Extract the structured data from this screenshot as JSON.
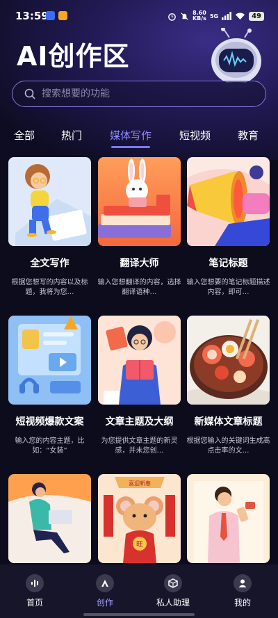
{
  "status": {
    "time": "13:59",
    "speed_value": "8.60",
    "speed_unit": "KB/s",
    "network": "5G",
    "battery": "49"
  },
  "header": {
    "title": "AI创作区"
  },
  "search": {
    "placeholder": "搜索想要的功能"
  },
  "tabs": [
    {
      "label": "全部"
    },
    {
      "label": "热门"
    },
    {
      "label": "媒体写作",
      "active": true
    },
    {
      "label": "短视频"
    },
    {
      "label": "教育"
    }
  ],
  "cards": [
    {
      "title": "全文写作",
      "desc": "根据您想写的内容以及标题，我将为您…"
    },
    {
      "title": "翻译大师",
      "desc": "输入您想翻译的内容，选择翻译语种…"
    },
    {
      "title": "笔记标题",
      "desc": "输入您想要的笔记标题描述内容，即可…"
    },
    {
      "title": "短视频爆款文案",
      "desc": "输入您的内容主题，比如：“女装”"
    },
    {
      "title": "文章主题及大纲",
      "desc": "为您提供文章主题的新灵感，并未您创…"
    },
    {
      "title": "新媒体文章标题",
      "desc": "根据您输入的关键词生成高点击率的文…"
    },
    {
      "title": "",
      "desc": ""
    },
    {
      "title": "",
      "desc": "",
      "poster_text": "喜迎新春",
      "badge": "旺"
    },
    {
      "title": "",
      "desc": ""
    }
  ],
  "nav": [
    {
      "label": "首页",
      "icon": "voice-icon"
    },
    {
      "label": "创作",
      "icon": "create-icon",
      "active": true
    },
    {
      "label": "私人助理",
      "icon": "box-icon"
    },
    {
      "label": "我的",
      "icon": "user-icon"
    }
  ],
  "colors": {
    "accent": "#7d78f5",
    "background": "#0d0c1c",
    "nav_bg": "#16152a"
  }
}
